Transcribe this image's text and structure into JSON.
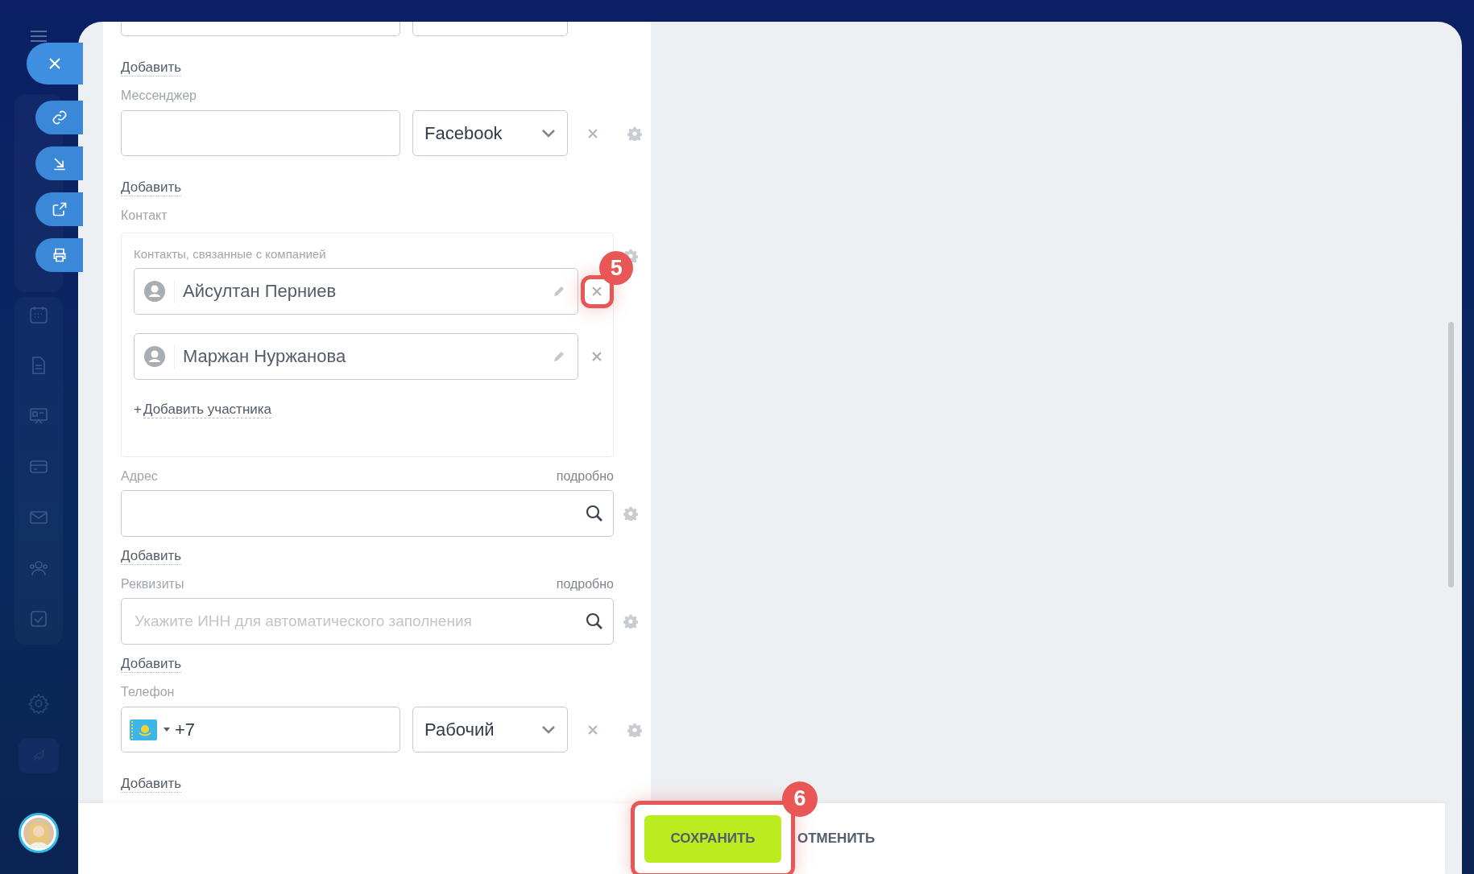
{
  "form": {
    "sections": [
      {
        "kind": "cut_row"
      },
      {
        "kind": "add_link",
        "text": "Добавить"
      },
      {
        "kind": "multifield",
        "label": "Мессенджер",
        "select": "Facebook"
      },
      {
        "kind": "add_link",
        "text": "Добавить"
      },
      {
        "kind": "contacts",
        "label": "Контакт",
        "box_label": "Контакты, связанные с компанией",
        "contacts": [
          {
            "name": "Айсултан Перниев",
            "highlighted": true,
            "badge": "5"
          },
          {
            "name": "Маржан Нуржанова",
            "highlighted": false
          }
        ],
        "add_sign": "+",
        "add_text": "Добавить участника"
      },
      {
        "kind": "search_field",
        "label": "Адрес",
        "link": "подробно"
      },
      {
        "kind": "add_link",
        "text": "Добавить"
      },
      {
        "kind": "search_field",
        "label": "Реквизиты",
        "link": "подробно",
        "placeholder": "Укажите ИНН для автоматического заполнения"
      },
      {
        "kind": "add_link",
        "text": "Добавить"
      },
      {
        "kind": "phone",
        "label": "Телефон",
        "value": "+7",
        "select": "Рабочий"
      },
      {
        "kind": "add_link",
        "text": "Добавить"
      }
    ]
  },
  "footer": {
    "save": "СОХРАНИТЬ",
    "cancel": "ОТМЕНИТЬ",
    "save_highlighted": true,
    "save_badge": "6"
  }
}
